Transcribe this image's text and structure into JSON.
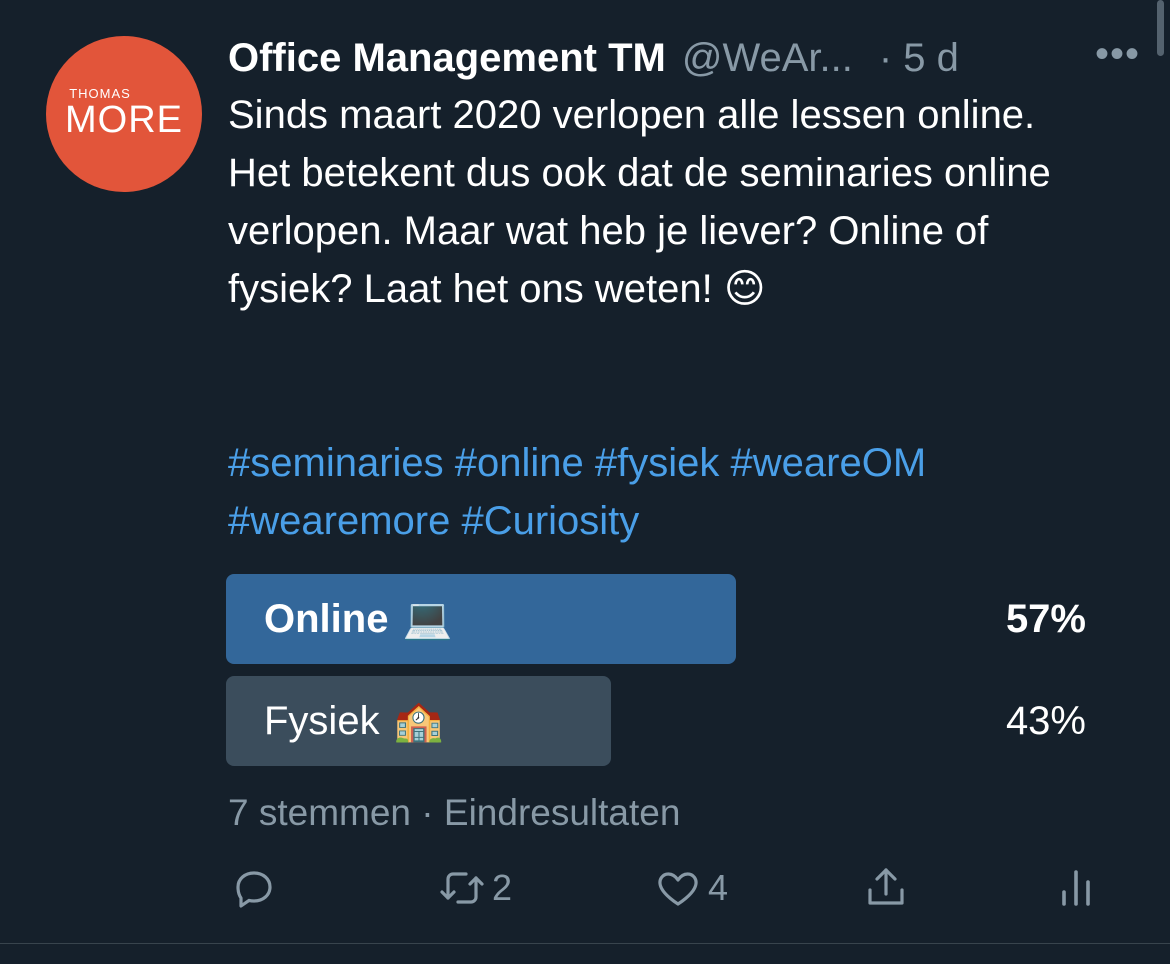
{
  "author": {
    "name": "Office Management TM",
    "handle": "@WeAr...",
    "time": "· 5 d",
    "avatar_text_small": "THOMAS",
    "avatar_text_big": "MORE",
    "avatar_color": "#e2553a"
  },
  "more_label": "•••",
  "tweet_text": "Sinds maart 2020 verlopen alle lessen online. Het betekent dus ook dat de seminaries online verlopen. Maar wat heb je liever? Online of fysiek? Laat het ons weten! 😊",
  "hashtags": [
    "#seminaries",
    "#online",
    "#fysiek",
    "#weareOM",
    "#wearemore",
    "#Curiosity"
  ],
  "poll": {
    "options": [
      {
        "label": "Online",
        "emoji": "💻",
        "percent_text": "57%",
        "percent": 57,
        "winner": true
      },
      {
        "label": "Fysiek",
        "emoji": "🏫",
        "percent_text": "43%",
        "percent": 43,
        "winner": false
      }
    ],
    "meta": "7 stemmen · Eindresultaten"
  },
  "actions": {
    "reply_count": "",
    "retweet_count": "2",
    "like_count": "4"
  },
  "colors": {
    "background": "#15202b",
    "link": "#4a9fe8",
    "winner_bar": "#33679a",
    "loser_bar": "#3b4d5c",
    "muted": "#8899a6"
  }
}
